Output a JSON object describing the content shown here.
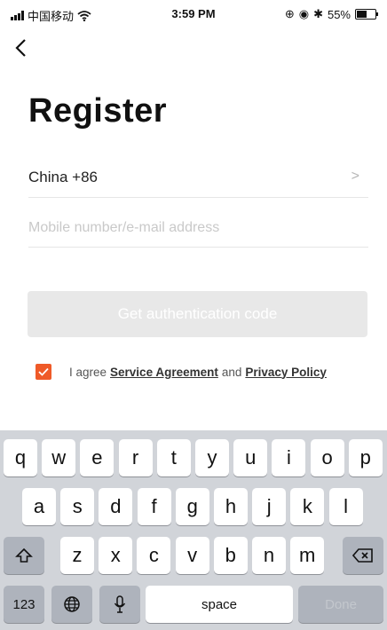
{
  "status": {
    "carrier": "中国移动",
    "time": "3:59 PM",
    "battery": "55%",
    "battery_level": 0.55
  },
  "nav": {
    "back_icon": "chevron-left-icon"
  },
  "page": {
    "title": "Register",
    "country_label": "China +86",
    "mobile_placeholder": "Mobile number/e-mail address",
    "auth_button": "Get authentication code",
    "agree_prefix": "I agree",
    "service_link": "Service Agreement",
    "and_text": "and",
    "privacy_link": "Privacy Policy",
    "checkbox_checked": true,
    "accent_color": "#ef5a28"
  },
  "keyboard": {
    "row1": [
      "q",
      "w",
      "e",
      "r",
      "t",
      "y",
      "u",
      "i",
      "o",
      "p"
    ],
    "row2": [
      "a",
      "s",
      "d",
      "f",
      "g",
      "h",
      "j",
      "k",
      "l"
    ],
    "row3": [
      "z",
      "x",
      "c",
      "v",
      "b",
      "n",
      "m"
    ],
    "numbers_key": "123",
    "space_key": "space",
    "done_key": "Done",
    "shift_icon": "shift-icon",
    "delete_icon": "backspace-icon",
    "globe_icon": "globe-icon",
    "mic_icon": "microphone-icon"
  }
}
